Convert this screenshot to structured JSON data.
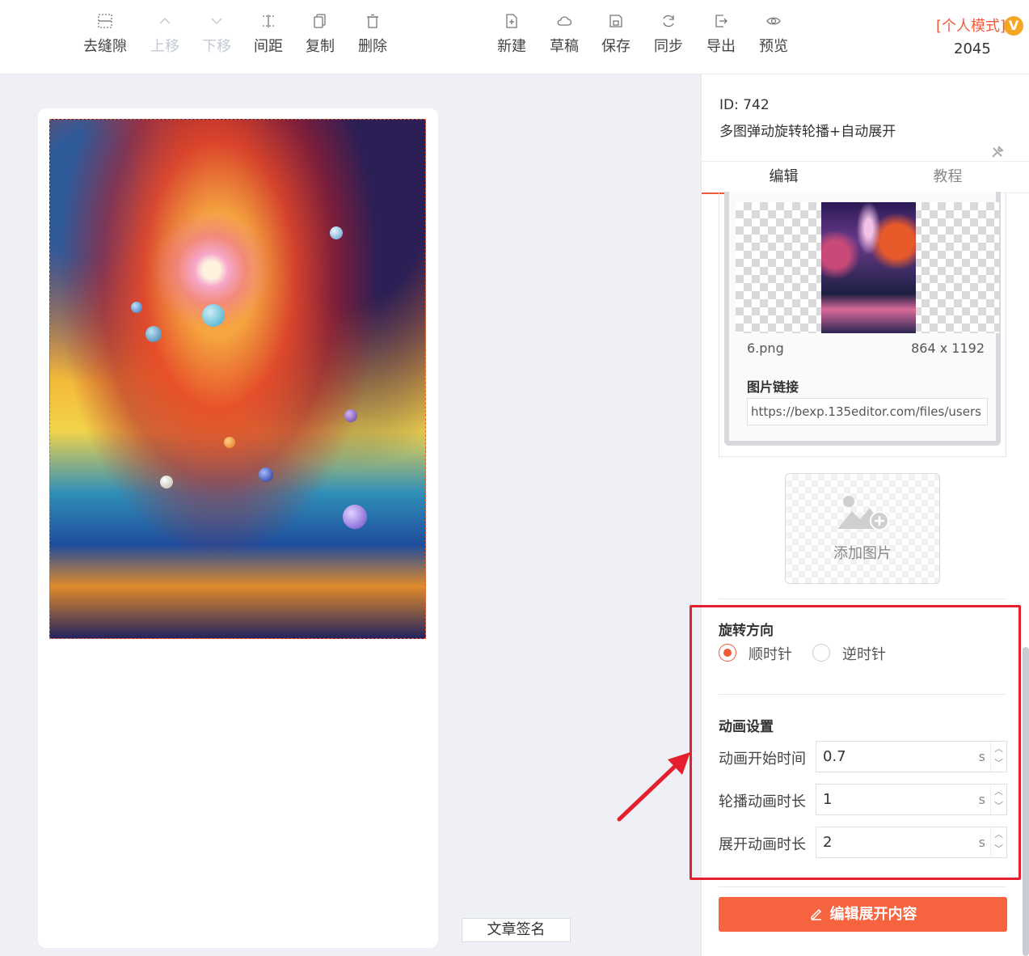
{
  "toolbar": {
    "left_items": [
      {
        "label": "去缝隙",
        "icon": "seam-icon",
        "disabled": false
      },
      {
        "label": "上移",
        "icon": "chevron-up-icon",
        "disabled": true
      },
      {
        "label": "下移",
        "icon": "chevron-down-icon",
        "disabled": true
      },
      {
        "label": "间距",
        "icon": "spacing-icon",
        "disabled": false
      },
      {
        "label": "复制",
        "icon": "copy-icon",
        "disabled": false
      },
      {
        "label": "删除",
        "icon": "trash-icon",
        "disabled": false
      }
    ],
    "right_items": [
      {
        "label": "新建",
        "icon": "new-file-icon"
      },
      {
        "label": "草稿",
        "icon": "cloud-icon"
      },
      {
        "label": "保存",
        "icon": "save-icon"
      },
      {
        "label": "同步",
        "icon": "sync-icon"
      },
      {
        "label": "导出",
        "icon": "export-icon"
      },
      {
        "label": "预览",
        "icon": "eye-icon"
      }
    ],
    "mode_label": "[个人模式]",
    "mode_badge": "V",
    "count": "2045"
  },
  "editor": {
    "signature_button": "文章签名"
  },
  "panel": {
    "id_text": "ID: 742",
    "title": "多图弹动旋转轮播+自动展开",
    "tabs": [
      {
        "label": "编辑",
        "active": true
      },
      {
        "label": "教程",
        "active": false
      }
    ],
    "image": {
      "filename": "6.png",
      "dimensions": "864 x 1192",
      "link_label": "图片链接",
      "link_value": "https://bexp.135editor.com/files/users"
    },
    "add_image_label": "添加图片",
    "rotation": {
      "title": "旋转方向",
      "options": [
        {
          "label": "顺时针",
          "selected": true
        },
        {
          "label": "逆时针",
          "selected": false
        }
      ]
    },
    "animation": {
      "title": "动画设置",
      "fields": [
        {
          "label": "动画开始时间",
          "value": "0.7",
          "unit": "s"
        },
        {
          "label": "轮播动画时长",
          "value": "1",
          "unit": "s"
        },
        {
          "label": "展开动画时长",
          "value": "2",
          "unit": "s"
        }
      ]
    },
    "edit_button": "编辑展开内容"
  },
  "colors": {
    "accent": "#f5633f",
    "highlight": "#e5202e",
    "mode_text": "#f05a3c",
    "badge": "#f5a623"
  }
}
